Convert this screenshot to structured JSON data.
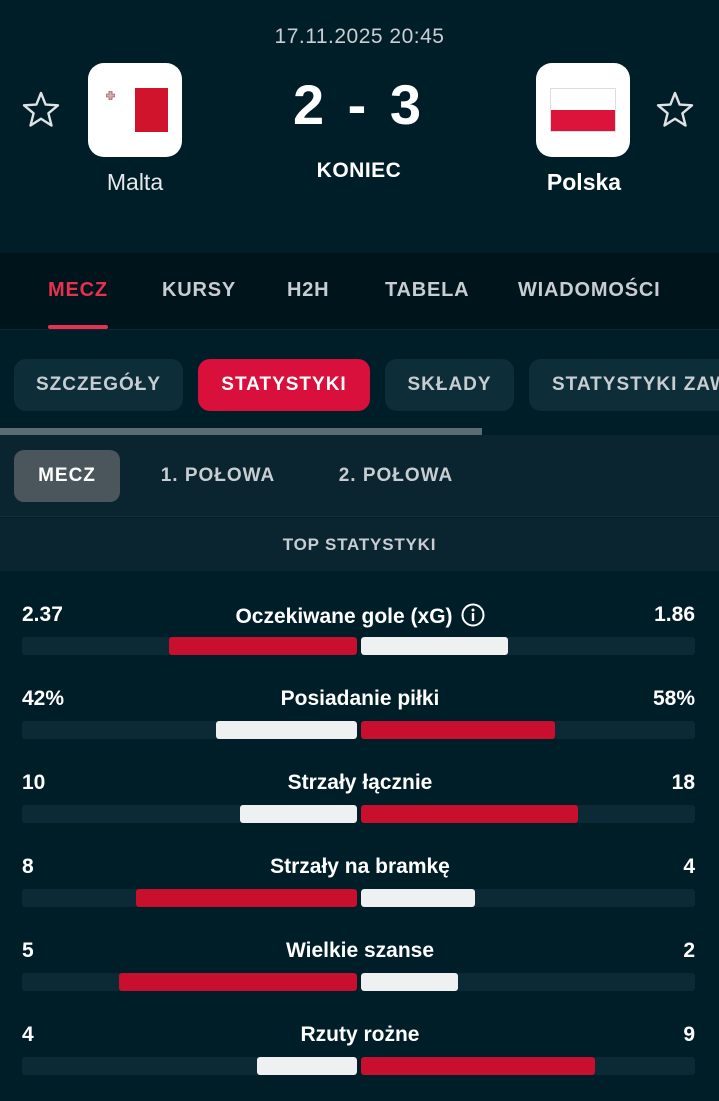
{
  "header": {
    "date": "17.11.2025 20:45",
    "score": "2 - 3",
    "status": "KONIEC",
    "home": {
      "name": "Malta",
      "flag": "malta-flag"
    },
    "away": {
      "name": "Polska",
      "flag": "poland-flag"
    }
  },
  "main_tabs": [
    {
      "label": "MECZ",
      "active": true
    },
    {
      "label": "KURSY",
      "active": false
    },
    {
      "label": "H2H",
      "active": false
    },
    {
      "label": "TABELA",
      "active": false
    },
    {
      "label": "WIADOMOŚCI",
      "active": false
    }
  ],
  "sub_tabs": [
    {
      "label": "SZCZEGÓŁY",
      "active": false
    },
    {
      "label": "STATYSTYKI",
      "active": true
    },
    {
      "label": "SKŁADY",
      "active": false
    },
    {
      "label": "STATYSTYKI ZAW",
      "active": false
    }
  ],
  "period_tabs": [
    {
      "label": "MECZ",
      "active": true
    },
    {
      "label": "1. POŁOWA",
      "active": false
    },
    {
      "label": "2. POŁOWA",
      "active": false
    }
  ],
  "section_title": "TOP STATYSTYKI",
  "stats": [
    {
      "label": "Oczekiwane gole (xG)",
      "home": "2.37",
      "away": "1.86",
      "home_fraction": 0.56,
      "away_fraction": 0.44,
      "info": true
    },
    {
      "label": "Posiadanie piłki",
      "home": "42%",
      "away": "58%",
      "home_fraction": 0.42,
      "away_fraction": 0.58,
      "info": false
    },
    {
      "label": "Strzały łącznie",
      "home": "10",
      "away": "18",
      "home_fraction": 0.35,
      "away_fraction": 0.65,
      "info": false
    },
    {
      "label": "Strzały na bramkę",
      "home": "8",
      "away": "4",
      "home_fraction": 0.66,
      "away_fraction": 0.34,
      "info": false
    },
    {
      "label": "Wielkie szanse",
      "home": "5",
      "away": "2",
      "home_fraction": 0.71,
      "away_fraction": 0.29,
      "info": false
    },
    {
      "label": "Rzuty rożne",
      "home": "4",
      "away": "9",
      "home_fraction": 0.3,
      "away_fraction": 0.7,
      "info": false
    }
  ],
  "colors": {
    "background": "#001e28",
    "accent_red": "#c8102e",
    "tab_active": "#e8304f",
    "bar_loser": "#eef0f1"
  }
}
